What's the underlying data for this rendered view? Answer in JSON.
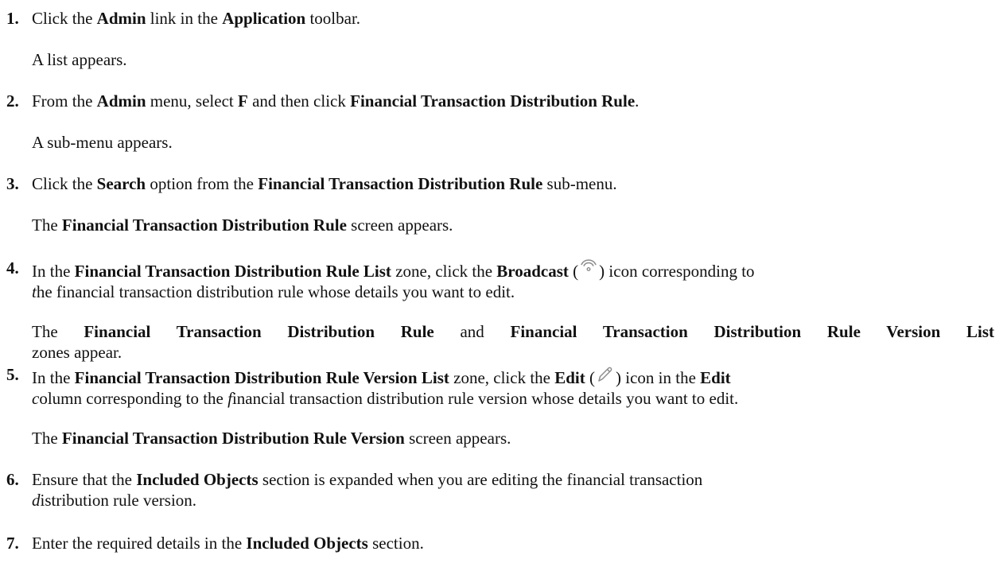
{
  "icons": {
    "broadcast": "broadcast-icon",
    "edit": "pencil-edit-icon"
  },
  "steps": [
    {
      "number": "1.",
      "instruction": [
        {
          "t": "Click the "
        },
        {
          "t": "Admin",
          "b": true
        },
        {
          "t": " link in the "
        },
        {
          "t": "Application",
          "b": true
        },
        {
          "t": " toolbar."
        }
      ],
      "result": [
        {
          "t": "A list appears."
        }
      ]
    },
    {
      "number": "2.",
      "instruction": [
        {
          "t": "From the "
        },
        {
          "t": "Admin",
          "b": true
        },
        {
          "t": " menu, select "
        },
        {
          "t": "F",
          "b": true
        },
        {
          "t": " and then click "
        },
        {
          "t": "Financial Transaction Distribution Rule",
          "b": true
        },
        {
          "t": "."
        }
      ],
      "result": [
        {
          "t": "A sub-menu appears."
        }
      ]
    },
    {
      "number": "3.",
      "instruction": [
        {
          "t": "Click the "
        },
        {
          "t": "Search",
          "b": true
        },
        {
          "t": " option from the "
        },
        {
          "t": "Financial Transaction Distribution Rule",
          "b": true
        },
        {
          "t": " sub-menu."
        }
      ],
      "result": [
        {
          "t": "The "
        },
        {
          "t": "Financial Transaction Distribution Rule",
          "b": true
        },
        {
          "t": " screen appears."
        }
      ]
    },
    {
      "number": "4.",
      "instruction_line1": [
        {
          "t": "In the "
        },
        {
          "t": "Financial Transaction Distribution Rule List",
          "b": true
        },
        {
          "t": " zone, click the "
        },
        {
          "t": "Broadcast",
          "b": true
        },
        {
          "t": " ("
        },
        {
          "icon": "broadcast"
        },
        {
          "t": ") icon corresponding to"
        }
      ],
      "instruction_line2": [
        {
          "t": "t",
          "i": true
        },
        {
          "t": "he financial transaction distribution rule whose details you want to edit."
        }
      ],
      "result_line1": [
        {
          "t": "The "
        },
        {
          "t": "Financial Transaction Distribution Rule",
          "b": true
        },
        {
          "t": " and "
        },
        {
          "t": "Financial Transaction Distribution Rule Version List",
          "b": true
        }
      ],
      "result_line2": [
        {
          "t": "zones appear."
        }
      ]
    },
    {
      "number": "5.",
      "instruction_line1": [
        {
          "t": "In the "
        },
        {
          "t": "Financial Transaction Distribution Rule Version List",
          "b": true
        },
        {
          "t": " zone, click the "
        },
        {
          "t": "Edit",
          "b": true
        },
        {
          "t": " ("
        },
        {
          "icon": "edit"
        },
        {
          "t": ") icon in the "
        },
        {
          "t": "Edit",
          "b": true
        }
      ],
      "instruction_line2": [
        {
          "t": "c",
          "i": true
        },
        {
          "t": "olumn corresponding to the "
        },
        {
          "t": "f",
          "i": true
        },
        {
          "t": "inancial transaction distribution rule version whose details you want to edit."
        }
      ],
      "result": [
        {
          "t": "The "
        },
        {
          "t": "Financial Transaction Distribution Rule Version",
          "b": true
        },
        {
          "t": " screen appears."
        }
      ]
    },
    {
      "number": "6.",
      "instruction_line1": [
        {
          "t": "Ensure that the "
        },
        {
          "t": "Included Objects",
          "b": true
        },
        {
          "t": " section is expanded when you are editing the financial transaction"
        }
      ],
      "instruction_line2": [
        {
          "t": "d",
          "i": true
        },
        {
          "t": "istribution rule version."
        }
      ]
    },
    {
      "number": "7.",
      "instruction": [
        {
          "t": "Enter the required details in the "
        },
        {
          "t": "Included Objects",
          "b": true
        },
        {
          "t": " section."
        }
      ]
    }
  ]
}
